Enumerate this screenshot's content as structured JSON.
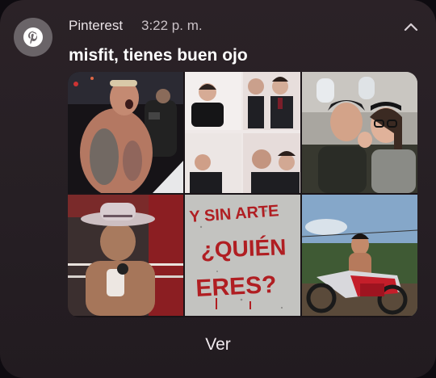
{
  "notification": {
    "app_name": "Pinterest",
    "time": "3:22 p. m.",
    "title": "misfit, tienes buen ojo",
    "action_label": "Ver"
  },
  "icons": {
    "app": "pinterest-logo-icon",
    "collapse": "chevron-up-icon"
  },
  "pins": [
    {
      "name": "wrestler-shouting"
    },
    {
      "name": "photobooth-strip"
    },
    {
      "name": "couple-selfie-plane"
    },
    {
      "name": "cowboy-hat-wrestler"
    },
    {
      "name": "wall-graffiti",
      "text_lines": [
        "Y SIN ARTE",
        "¿QUIÉN",
        "ERES?"
      ]
    },
    {
      "name": "motocross-rider"
    }
  ],
  "colors": {
    "card_bg": "#2b2227",
    "icon_bg": "#6a6468",
    "graffiti_red": "#b01e22"
  }
}
